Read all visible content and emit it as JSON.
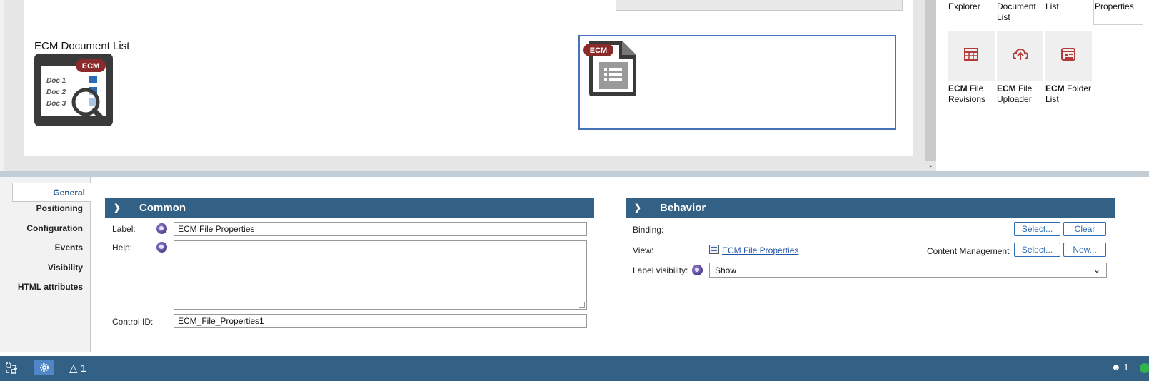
{
  "canvas": {
    "doclist_label": "ECM Document List",
    "doclist_icon": {
      "badge": "ECM",
      "rows": [
        "Doc 1",
        "Doc 2",
        "Doc 3"
      ]
    },
    "fileprops_badge": "ECM"
  },
  "palette": {
    "top_row": [
      {
        "line1": "Explorer",
        "line2": ""
      },
      {
        "line1": "Document",
        "line2": "List"
      },
      {
        "line1": "List",
        "line2": ""
      },
      {
        "line1": "Properties",
        "line2": ""
      }
    ],
    "tiles": [
      {
        "bold": "ECM",
        "rest": " File",
        "line2": "Revisions",
        "icon": "table-icon"
      },
      {
        "bold": "ECM",
        "rest": " File",
        "line2": "Uploader",
        "icon": "cloud-upload-icon"
      },
      {
        "bold": "ECM",
        "rest": " Folder",
        "line2": "List",
        "icon": "folder-list-icon"
      }
    ]
  },
  "side_tabs": [
    "General",
    "Positioning",
    "Configuration",
    "Events",
    "Visibility",
    "HTML attributes"
  ],
  "common": {
    "title": "Common",
    "label_label": "Label:",
    "label_value": "ECM File Properties",
    "help_label": "Help:",
    "help_value": "",
    "control_id_label": "Control ID:",
    "control_id_value": "ECM_File_Properties1"
  },
  "behavior": {
    "title": "Behavior",
    "binding_label": "Binding:",
    "select_button": "Select...",
    "clear_button": "Clear",
    "view_label": "View:",
    "view_link": "ECM File Properties",
    "content_mgmt_label": "Content Management",
    "select_button2": "Select...",
    "new_button": "New...",
    "label_visibility_label": "Label visibility:",
    "label_visibility_value": "Show"
  },
  "statusbar": {
    "warning_count": "1",
    "user_count": "1"
  },
  "colors": {
    "header_blue": "#336185",
    "ecm_badge": "#8b2a2a",
    "selection_border": "#4872b8",
    "ok_green": "#2eb54a"
  }
}
